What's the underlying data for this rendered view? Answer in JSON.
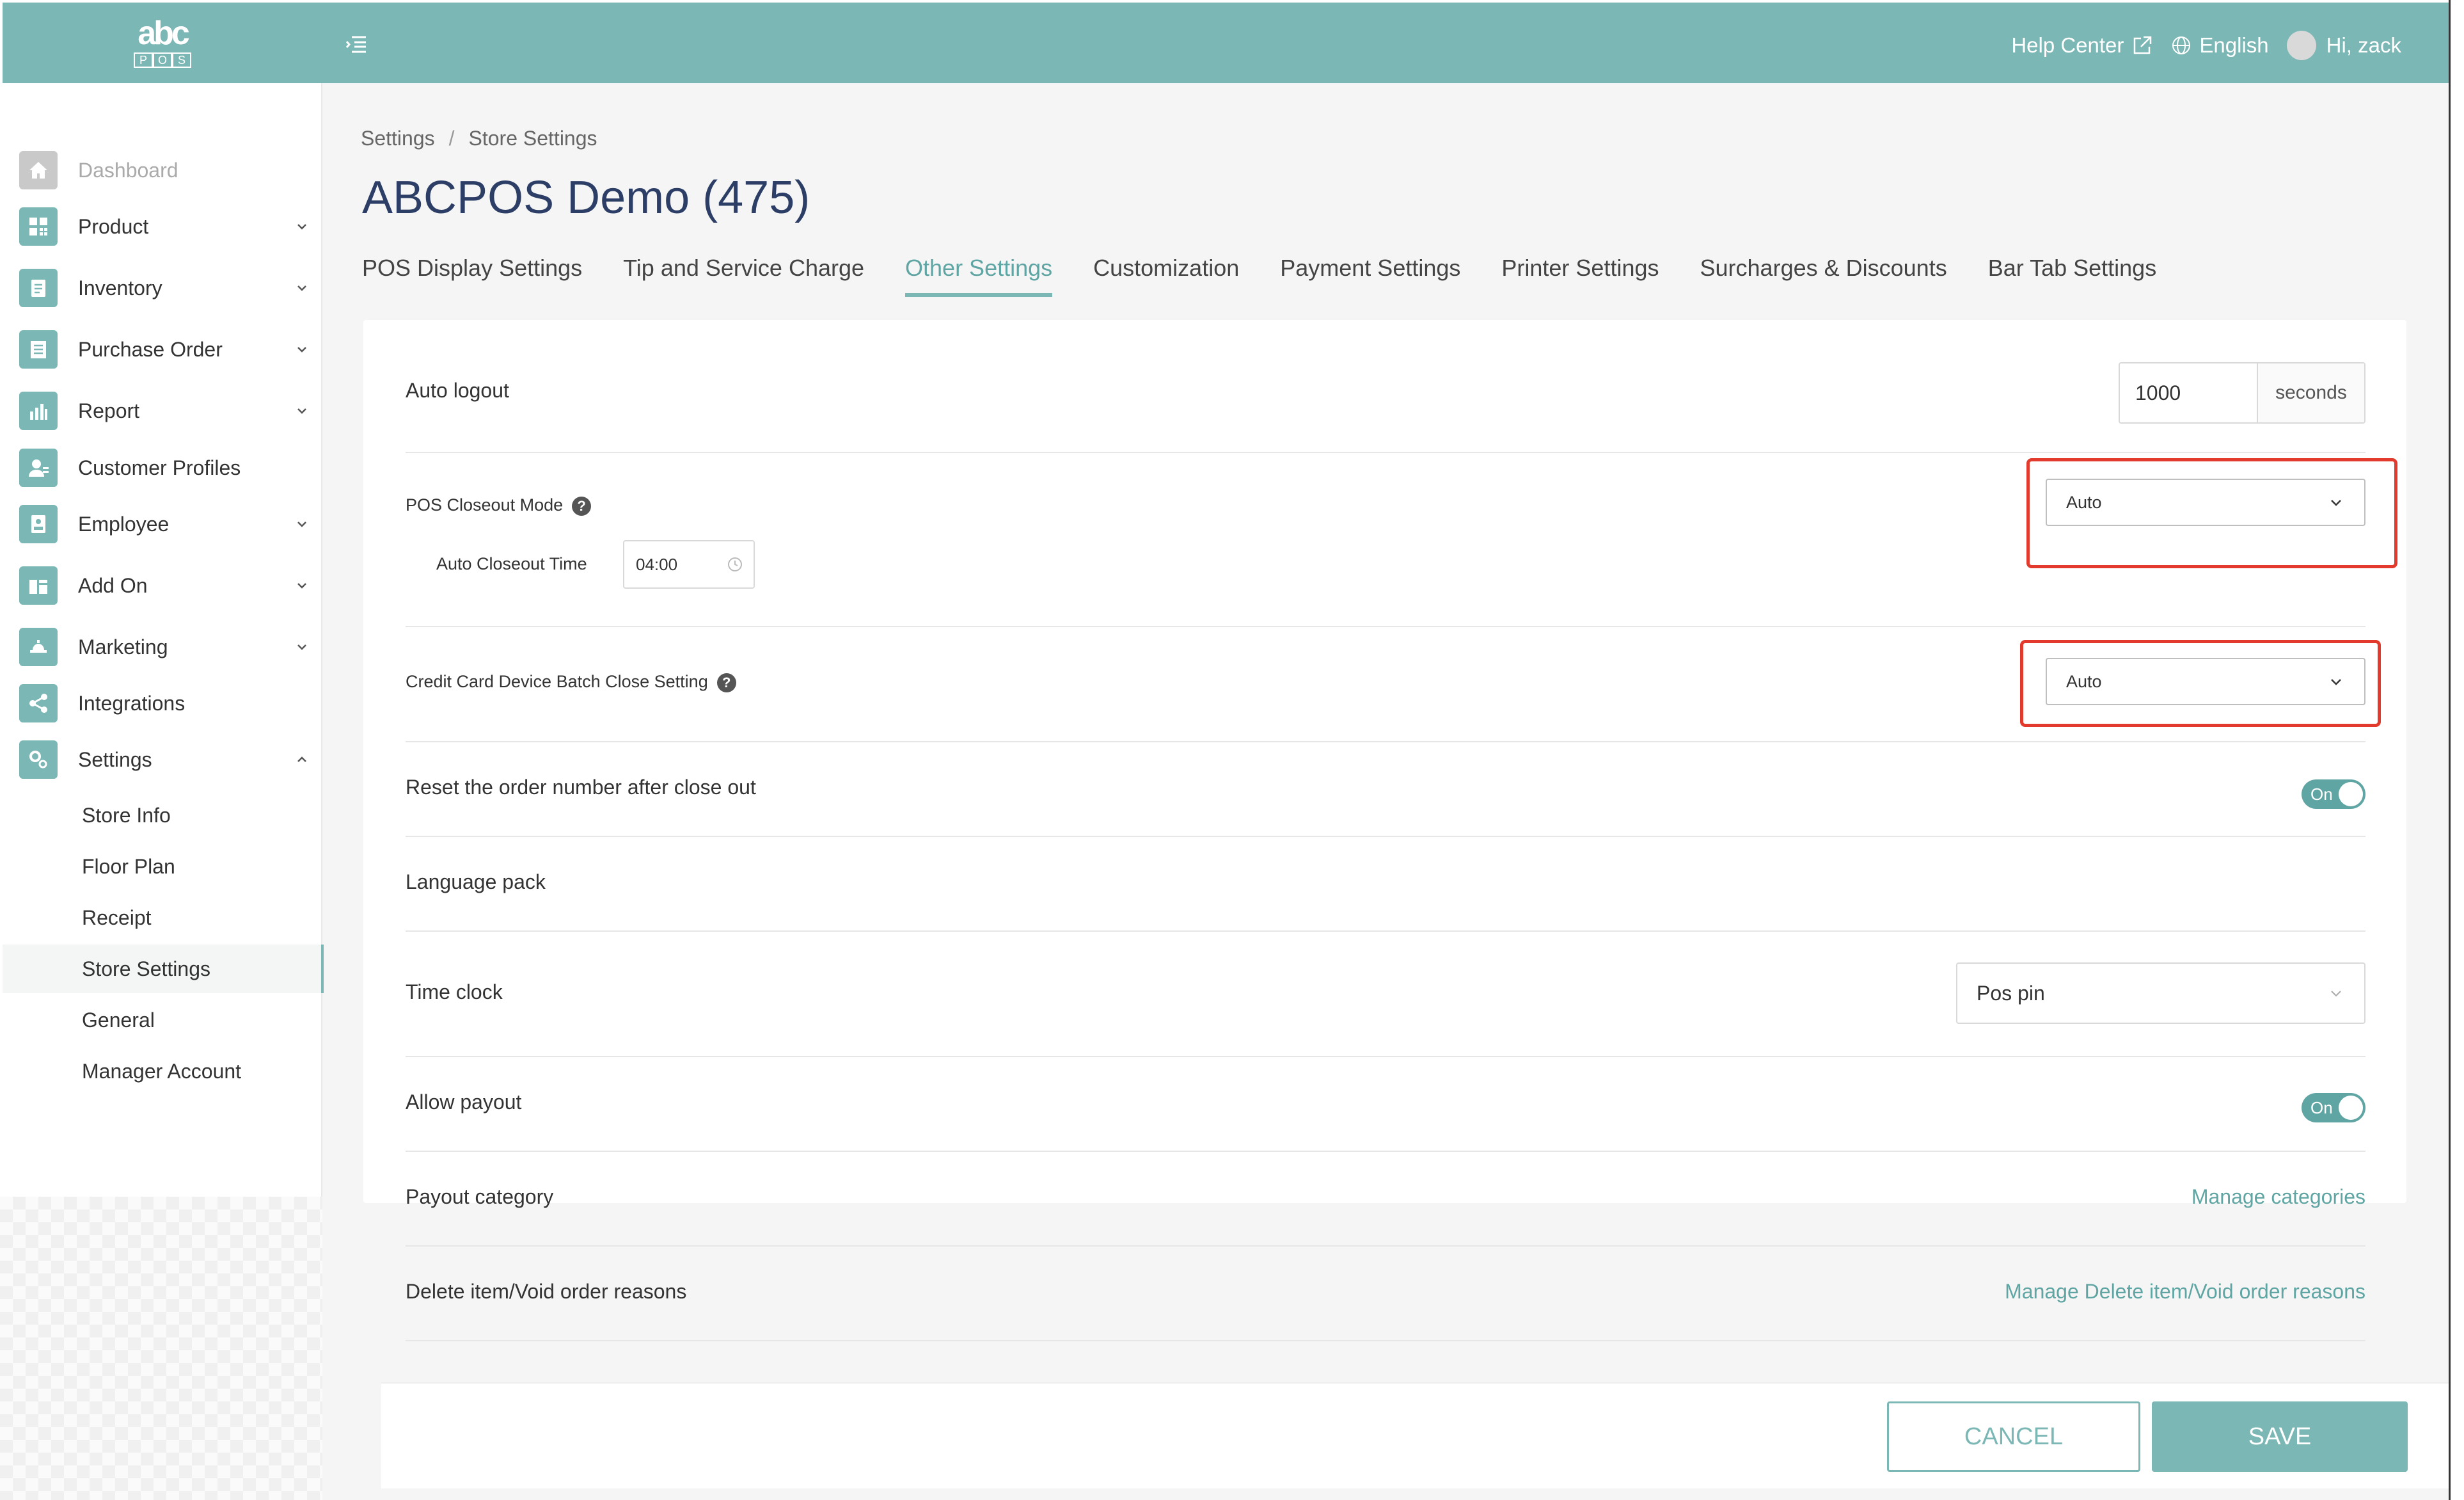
{
  "header": {
    "logo_text": "abc",
    "logo_sub": [
      "P",
      "O",
      "S"
    ],
    "help_center": "Help Center",
    "language": "English",
    "greeting": "Hi, zack"
  },
  "sidebar": {
    "items": [
      {
        "label": "Dashboard",
        "icon": "home-icon"
      },
      {
        "label": "Product",
        "icon": "grid-icon"
      },
      {
        "label": "Inventory",
        "icon": "clipboard-icon"
      },
      {
        "label": "Purchase Order",
        "icon": "receipt-icon"
      },
      {
        "label": "Report",
        "icon": "bar-chart-icon"
      },
      {
        "label": "Customer Profiles",
        "icon": "user-card-icon"
      },
      {
        "label": "Employee",
        "icon": "badge-icon"
      },
      {
        "label": "Add On",
        "icon": "puzzle-icon"
      },
      {
        "label": "Marketing",
        "icon": "megaphone-icon"
      },
      {
        "label": "Integrations",
        "icon": "share-icon"
      },
      {
        "label": "Settings",
        "icon": "gear-icon"
      }
    ],
    "settings_sub": [
      "Store Info",
      "Floor Plan",
      "Receipt",
      "Store Settings",
      "General",
      "Manager Account"
    ]
  },
  "breadcrumb": {
    "root": "Settings",
    "current": "Store Settings"
  },
  "page_title": "ABCPOS Demo (475)",
  "tabs": [
    "POS Display Settings",
    "Tip and Service Charge",
    "Other Settings",
    "Customization",
    "Payment Settings",
    "Printer Settings",
    "Surcharges & Discounts",
    "Bar Tab Settings"
  ],
  "settings": {
    "auto_logout": {
      "label": "Auto logout",
      "value": "1000",
      "unit": "seconds"
    },
    "closeout_mode": {
      "label": "POS Closeout Mode",
      "value": "Auto",
      "help": "?"
    },
    "closeout_time": {
      "label": "Auto Closeout Time",
      "value": "04:00"
    },
    "batch_close": {
      "label": "Credit Card Device Batch Close Setting",
      "value": "Auto",
      "help": "?"
    },
    "reset_order": {
      "label": "Reset the order number after close out",
      "toggle": "On"
    },
    "language_pack": {
      "label": "Language pack"
    },
    "time_clock": {
      "label": "Time clock",
      "value": "Pos pin"
    },
    "allow_payout": {
      "label": "Allow payout",
      "toggle": "On"
    },
    "payout_category": {
      "label": "Payout category",
      "link": "Manage categories"
    },
    "delete_reasons": {
      "label": "Delete item/Void order reasons",
      "link": "Manage Delete item/Void order reasons"
    }
  },
  "footer": {
    "cancel": "CANCEL",
    "save": "SAVE"
  },
  "colors": {
    "accent": "#7bb7b5",
    "highlight": "#e23b2e",
    "title": "#2c3e66"
  }
}
